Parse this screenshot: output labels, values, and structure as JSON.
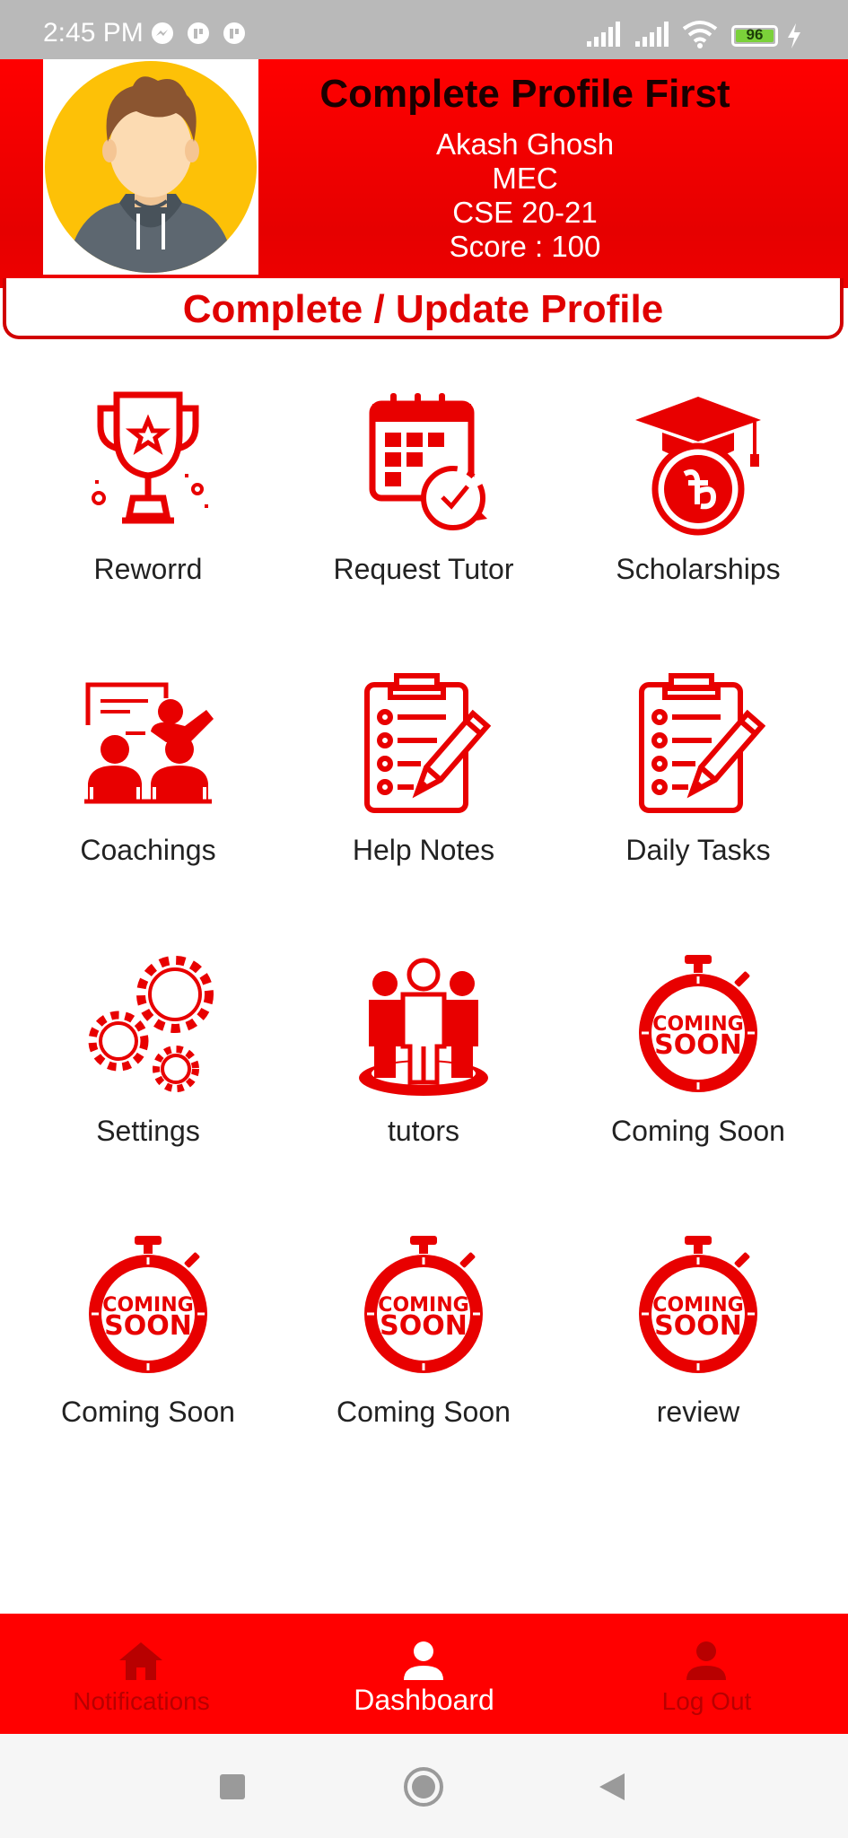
{
  "status_bar": {
    "time": "2:45 PM",
    "battery": "96"
  },
  "header": {
    "title": "Complete Profile First",
    "name": "Akash Ghosh",
    "institute": "MEC",
    "batch": "CSE 20-21",
    "score": "Score : 100",
    "profile_button": "Complete / Update Profile"
  },
  "grid": {
    "items": [
      {
        "label": "Reworrd",
        "icon": "trophy-icon"
      },
      {
        "label": "Request Tutor",
        "icon": "calendar-clock-icon"
      },
      {
        "label": "Scholarships",
        "icon": "graduation-cap-icon"
      },
      {
        "label": "Coachings",
        "icon": "classroom-icon"
      },
      {
        "label": "Help Notes",
        "icon": "clipboard-pencil-icon"
      },
      {
        "label": "Daily Tasks",
        "icon": "clipboard-pencil-icon"
      },
      {
        "label": "Settings",
        "icon": "gears-icon"
      },
      {
        "label": "tutors",
        "icon": "group-icon"
      },
      {
        "label": "Coming Soon",
        "icon": "coming-soon-icon"
      },
      {
        "label": "Coming Soon",
        "icon": "coming-soon-icon"
      },
      {
        "label": "Coming Soon",
        "icon": "coming-soon-icon"
      },
      {
        "label": "review",
        "icon": "coming-soon-icon"
      }
    ],
    "coming_soon_line1": "COMING",
    "coming_soon_line2": "SOON"
  },
  "bottom_nav": {
    "items": [
      {
        "label": "Notifications",
        "icon": "home-icon",
        "active": false
      },
      {
        "label": "Dashboard",
        "icon": "person-icon",
        "active": true
      },
      {
        "label": "Log Out",
        "icon": "person-icon",
        "active": false
      }
    ]
  },
  "colors": {
    "primary": "#ff0000",
    "icon_red": "#e80000",
    "text": "#222222"
  }
}
